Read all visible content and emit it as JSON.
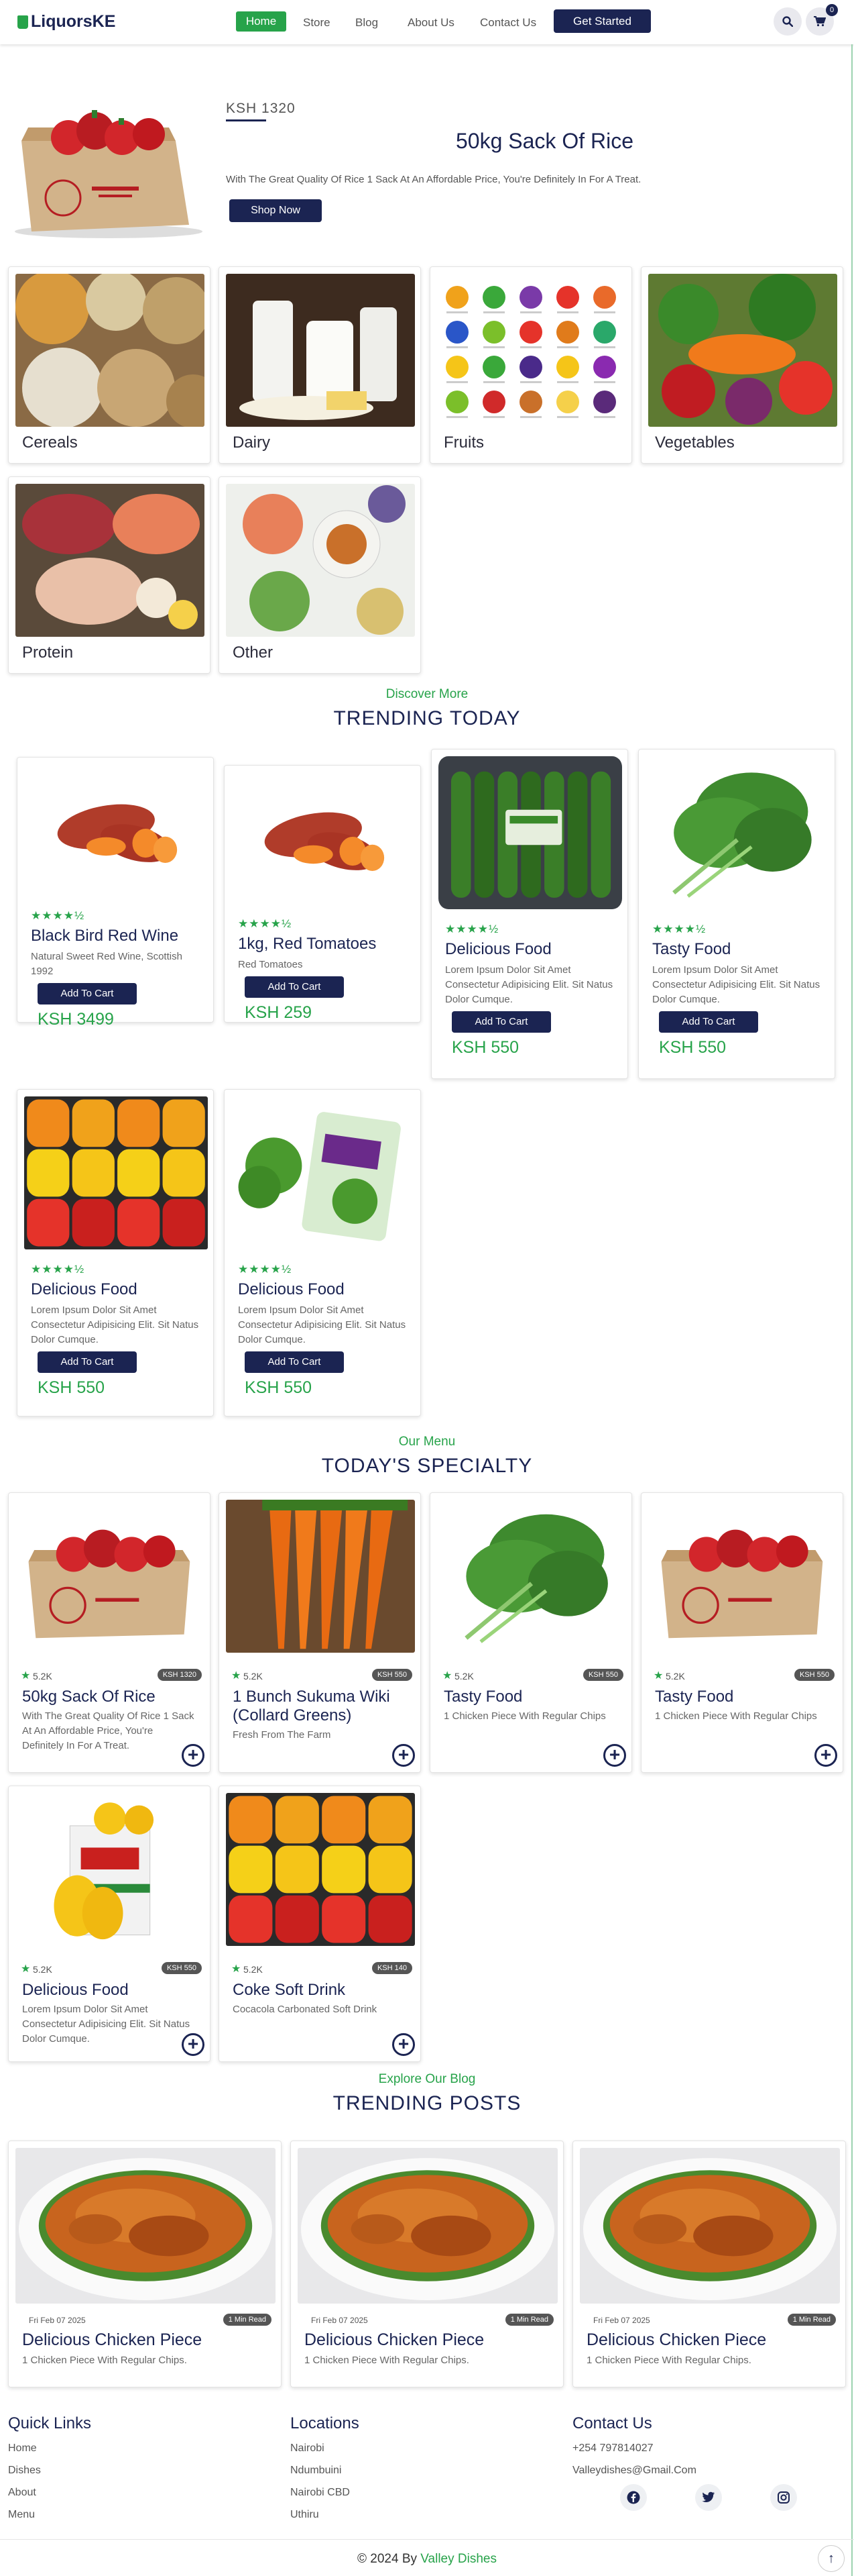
{
  "nav": {
    "brand": "LiquorsKE",
    "links": [
      "Home",
      "Store",
      "Blog",
      "About Us",
      "Contact Us"
    ],
    "cta": "Get Started",
    "cart_count": "0",
    "icons": [
      "search-icon",
      "cart-icon"
    ]
  },
  "hero": {
    "price": "KSH 1320",
    "title": "50kg Sack Of Rice",
    "description": "With The Great Quality Of Rice 1 Sack At An Affordable Price, You're Definitely In For A Treat.",
    "button": "Shop Now"
  },
  "categories": [
    "Cereals",
    "Dairy",
    "Fruits",
    "Vegetables",
    "Protein",
    "Other"
  ],
  "trending": {
    "subtitle": "Discover More",
    "title": "TRENDING TODAY",
    "button_label": "Add To Cart",
    "stars": "★★★★½",
    "items": [
      {
        "name": "Black Bird Red Wine",
        "desc": "Natural Sweet Red Wine, Scottish 1992",
        "price": "KSH 3499",
        "image": "sweet-potatoes"
      },
      {
        "name": "1kg, Red Tomatoes",
        "desc": "Red Tomatoes",
        "price": "KSH 259",
        "image": "sweet-potatoes"
      },
      {
        "name": "Delicious Food",
        "desc": "Lorem Ipsum Dolor Sit Amet Consectetur Adipisicing Elit. Sit Natus Dolor Cumque.",
        "price": "KSH 550",
        "image": "cucumbers"
      },
      {
        "name": "Tasty Food",
        "desc": "Lorem Ipsum Dolor Sit Amet Consectetur Adipisicing Elit. Sit Natus Dolor Cumque.",
        "price": "KSH 550",
        "image": "collard-greens"
      },
      {
        "name": "Delicious Food",
        "desc": "Lorem Ipsum Dolor Sit Amet Consectetur Adipisicing Elit. Sit Natus Dolor Cumque.",
        "price": "KSH 550",
        "image": "bell-peppers"
      },
      {
        "name": "Delicious Food",
        "desc": "Lorem Ipsum Dolor Sit Amet Consectetur Adipisicing Elit. Sit Natus Dolor Cumque.",
        "price": "KSH 550",
        "image": "watercress"
      }
    ]
  },
  "specialty": {
    "subtitle": "Our Menu",
    "title": "TODAY'S SPECIALTY",
    "rating": "5.2K",
    "items": [
      {
        "name": "50kg Sack Of Rice",
        "desc": "With The Great Quality Of Rice 1 Sack At An Affordable Price, You're Definitely In For A Treat.",
        "price": "KSH 1320",
        "image": "pepper-box"
      },
      {
        "name": "1 Bunch Sukuma Wiki (Collard Greens)",
        "desc": "Fresh From The Farm",
        "price": "KSH 550",
        "image": "carrots"
      },
      {
        "name": "Tasty Food",
        "desc": "1 Chicken Piece With Regular Chips",
        "price": "KSH 550",
        "image": "collard-greens"
      },
      {
        "name": "Tasty Food",
        "desc": "1 Chicken Piece With Regular Chips",
        "price": "KSH 550",
        "image": "pepper-box"
      },
      {
        "name": "Delicious Food",
        "desc": "Lorem Ipsum Dolor Sit Amet Consectetur Adipisicing Elit. Sit Natus Dolor Cumque.",
        "price": "KSH 550",
        "image": "yellow-pepper-box"
      },
      {
        "name": "Coke Soft Drink",
        "desc": "Cocacola Carbonated Soft Drink",
        "price": "KSH 140",
        "image": "bell-peppers"
      }
    ]
  },
  "posts": {
    "subtitle": "Explore Our Blog",
    "title": "TRENDING POSTS",
    "items": [
      {
        "date": "Fri Feb 07 2025",
        "read": "1 Min Read",
        "title": "Delicious Chicken Piece",
        "desc": "1 Chicken Piece With Regular Chips."
      },
      {
        "date": "Fri Feb 07 2025",
        "read": "1 Min Read",
        "title": "Delicious Chicken Piece",
        "desc": "1 Chicken Piece With Regular Chips."
      },
      {
        "date": "Fri Feb 07 2025",
        "read": "1 Min Read",
        "title": "Delicious Chicken Piece",
        "desc": "1 Chicken Piece With Regular Chips."
      }
    ]
  },
  "footer": {
    "quick_links": {
      "title": "Quick Links",
      "items": [
        "Home",
        "Dishes",
        "About",
        "Menu"
      ]
    },
    "locations": {
      "title": "Locations",
      "items": [
        "Nairobi",
        "Ndumbuini",
        "Nairobi CBD",
        "Uthiru"
      ]
    },
    "contact": {
      "title": "Contact Us",
      "phone": "+254 797814027",
      "email": "Valleydishes@Gmail.Com"
    },
    "social_icons": [
      "facebook-icon",
      "twitter-icon",
      "instagram-icon"
    ],
    "copyright": "© 2024 By",
    "copyright_brand": "Valley Dishes"
  },
  "colors": {
    "navy": "#1b2452",
    "green": "#27a34a"
  }
}
